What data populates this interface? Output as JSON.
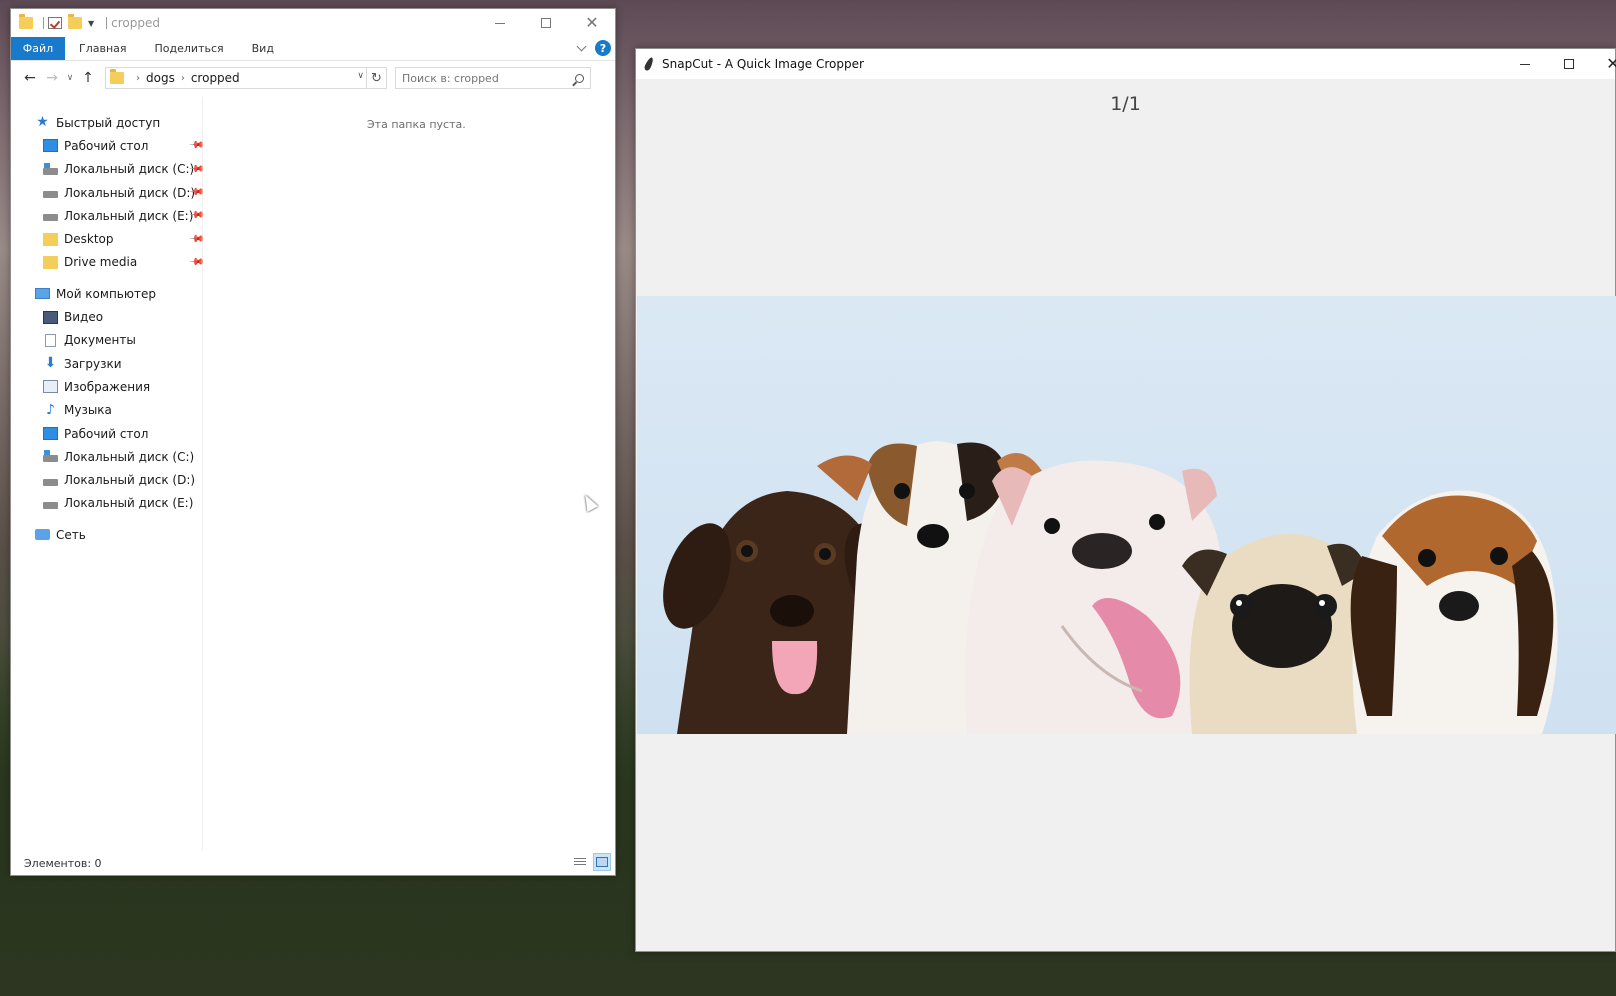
{
  "explorer": {
    "window_title": "cropped",
    "ribbon": {
      "file": "Файл",
      "home": "Главная",
      "share": "Поделиться",
      "view": "Вид",
      "help": "?"
    },
    "breadcrumb": [
      "dogs",
      "cropped"
    ],
    "search_placeholder": "Поиск в: cropped",
    "nav": {
      "quick_access": "Быстрый доступ",
      "quick_items": [
        {
          "label": "Рабочий стол",
          "icon": "monitor-icon"
        },
        {
          "label": "Локальный диск (C:)",
          "icon": "windows-drive-icon"
        },
        {
          "label": "Локальный диск (D:)",
          "icon": "drive-icon"
        },
        {
          "label": "Локальный диск (E:)",
          "icon": "drive-icon"
        },
        {
          "label": "Desktop",
          "icon": "folder-icon"
        },
        {
          "label": "Drive media",
          "icon": "folder-icon"
        }
      ],
      "my_computer": "Мой компьютер",
      "computer_items": [
        {
          "label": "Видео",
          "icon": "video-icon"
        },
        {
          "label": "Документы",
          "icon": "document-icon"
        },
        {
          "label": "Загрузки",
          "icon": "download-icon"
        },
        {
          "label": "Изображения",
          "icon": "image-icon"
        },
        {
          "label": "Музыка",
          "icon": "music-icon"
        },
        {
          "label": "Рабочий стол",
          "icon": "monitor-icon"
        },
        {
          "label": "Локальный диск (C:)",
          "icon": "windows-drive-icon"
        },
        {
          "label": "Локальный диск (D:)",
          "icon": "drive-icon"
        },
        {
          "label": "Локальный диск (E:)",
          "icon": "drive-icon"
        }
      ],
      "network": "Сеть"
    },
    "empty_message": "Эта папка пуста.",
    "status": "Элементов: 0"
  },
  "snapcut": {
    "window_title": "SnapCut - A Quick Image Cropper",
    "counter": "1/1",
    "image": {
      "subject": "five puppies in a row",
      "dogs": [
        "chocolate labrador",
        "jack russell terrier",
        "english bulldog",
        "pug",
        "beagle"
      ]
    }
  },
  "colors": {
    "accent": "#1979ca",
    "image_background": "#d6e6f3"
  }
}
